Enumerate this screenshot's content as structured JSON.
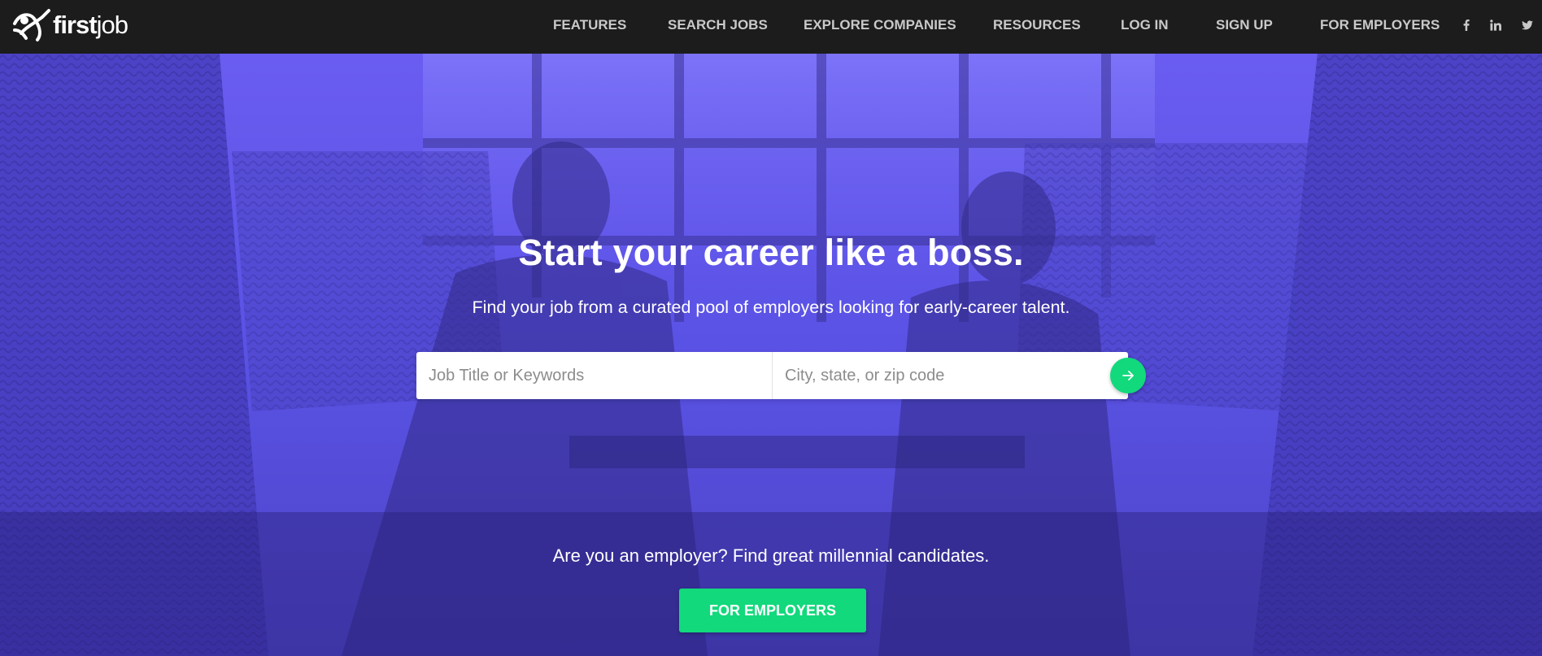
{
  "brand": {
    "logo_bold": "first",
    "logo_light": "job"
  },
  "nav": {
    "items": [
      {
        "label": "FEATURES"
      },
      {
        "label": "SEARCH JOBS"
      },
      {
        "label": "EXPLORE COMPANIES"
      },
      {
        "label": "RESOURCES"
      },
      {
        "label": "LOG IN"
      },
      {
        "label": "SIGN UP"
      },
      {
        "label": "FOR EMPLOYERS"
      }
    ],
    "social": [
      "facebook-icon",
      "linkedin-icon",
      "twitter-icon"
    ]
  },
  "hero": {
    "title": "Start your career like a boss.",
    "subtitle": "Find your job from a curated pool of employers looking for early-career talent.",
    "search": {
      "keywords_placeholder": "Job Title or Keywords",
      "location_placeholder": "City, state, or zip code",
      "submit_icon": "arrow-right-icon"
    }
  },
  "employer_band": {
    "text": "Are you an employer? Find great millennial candidates.",
    "button_label": "FOR EMPLOYERS"
  },
  "colors": {
    "nav_bg": "#1c1c1c",
    "nav_text": "#c9c9c9",
    "hero_tint": "#5b53e6",
    "accent_green": "#12d97c"
  }
}
